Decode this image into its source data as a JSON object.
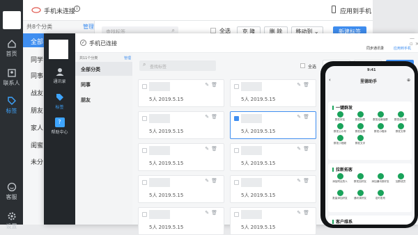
{
  "back": {
    "status": "手机未连接",
    "apply_to_phone": "应用到手机",
    "category_count": "共8个分类",
    "manage": "管理",
    "side_items": [
      "全部",
      "同学",
      "同事",
      "战友",
      "朋友",
      "家人",
      "闺蜜",
      "未分"
    ],
    "rail": [
      {
        "label": "首页"
      },
      {
        "label": "联系人"
      },
      {
        "label": "标签"
      },
      {
        "label": "客服"
      },
      {
        "label": "设置"
      }
    ],
    "search_placeholder": "查找标签",
    "select_all": "全选",
    "clone": "克 隆",
    "delete": "删 除",
    "move_to": "移动到",
    "new_tag": "新建标签"
  },
  "front": {
    "status": "手机已连接",
    "sync_contacts": "同步通讯录",
    "apply_to_phone": "应用到手机",
    "category_count": "共11个分类",
    "manage": "管理",
    "side_items": [
      "全部分类",
      "同事",
      "朋友"
    ],
    "rail": [
      {
        "label": "通讯录"
      },
      {
        "label": "标签"
      },
      {
        "label": "帮助中心"
      }
    ],
    "search_placeholder": "查找标签",
    "select_all": "全选",
    "cards": [
      {
        "meta": "5人  2019.5.15",
        "selected": false
      },
      {
        "meta": "5人  2019.5.15",
        "selected": false
      },
      {
        "meta": "5人  2019.5.15",
        "selected": false
      },
      {
        "meta": "5人  2019.5.15",
        "selected": true
      },
      {
        "meta": "5人  2019.5.15",
        "selected": false
      },
      {
        "meta": "5人  2019.5.15",
        "selected": false
      },
      {
        "meta": "5人  2019.5.15",
        "selected": false
      },
      {
        "meta": "5人  2019.5.15",
        "selected": false
      },
      {
        "meta": "5人  2019.5.15",
        "selected": false
      },
      {
        "meta": "5人  2019.5.15",
        "selected": false
      }
    ]
  },
  "phone": {
    "time": "9:41",
    "title": "里德助手",
    "sec1": {
      "title": "一键群发",
      "items": [
        "群发好友",
        "群发标签",
        "群发给微信群",
        "群发给标签",
        "群发公众号",
        "群发给群",
        "群发小程序",
        "群发文章",
        "群发小视频",
        "群发文字"
      ]
    },
    "sec2": {
      "title": "拉新拓客",
      "items": [
        "添加附近的人",
        "群发加好友",
        "添加通讯录好友",
        "加群成员",
        "批量添加好友",
        "通讯录好友",
        "定时发布"
      ]
    },
    "sec3": {
      "title": "客户维系"
    },
    "accent": "#1aa35b"
  }
}
